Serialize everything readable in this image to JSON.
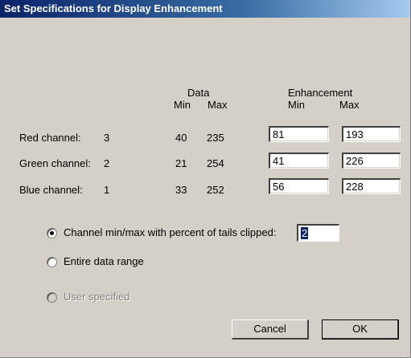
{
  "window": {
    "title": "Set Specifications for Display Enhancement"
  },
  "headers": {
    "data": "Data",
    "enhancement": "Enhancement",
    "min": "Min",
    "max": "Max"
  },
  "channels": [
    {
      "label": "Red channel:",
      "band": "3",
      "data_min": "40",
      "data_max": "235",
      "enh_min": "81",
      "enh_max": "193"
    },
    {
      "label": "Green channel:",
      "band": "2",
      "data_min": "21",
      "data_max": "254",
      "enh_min": "41",
      "enh_max": "226"
    },
    {
      "label": "Blue channel:",
      "band": "1",
      "data_min": "33",
      "data_max": "252",
      "enh_min": "56",
      "enh_max": "228"
    }
  ],
  "options": {
    "percent_label": "Channel min/max with percent of tails clipped:",
    "percent_value": "2",
    "entire_label": "Entire data range",
    "user_label": "User specified"
  },
  "buttons": {
    "cancel": "Cancel",
    "ok": "OK"
  }
}
